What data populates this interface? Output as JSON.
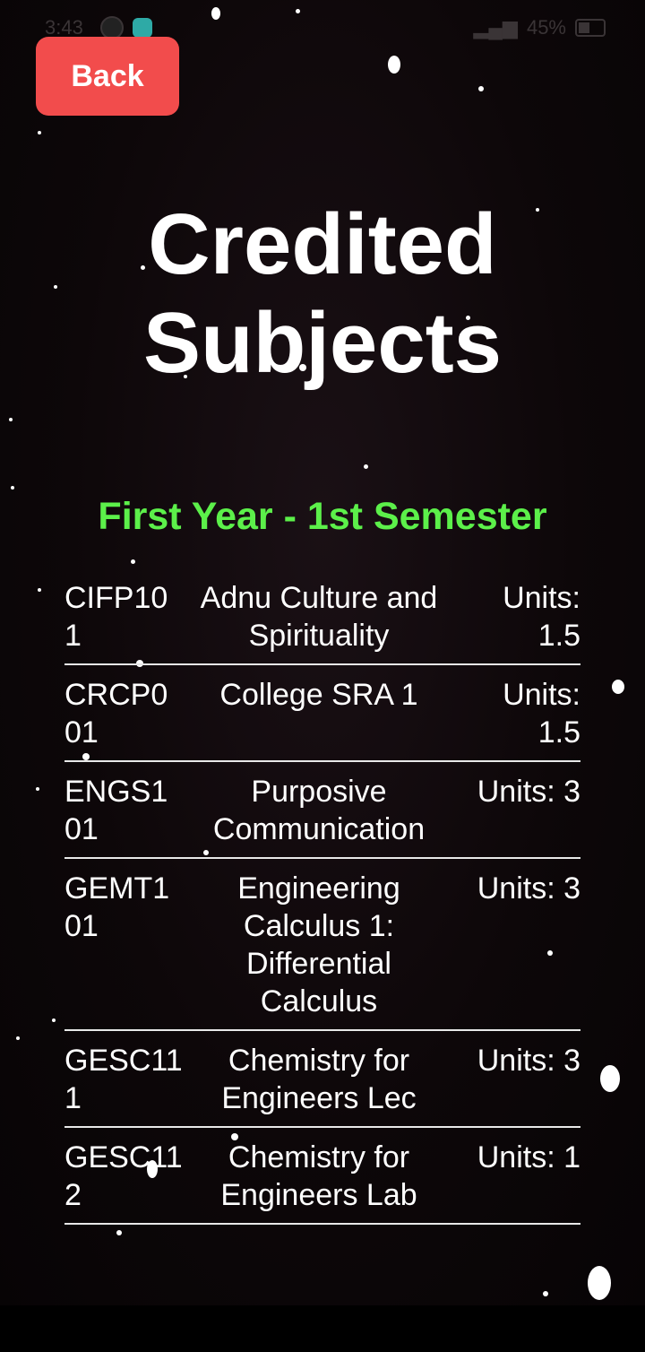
{
  "status_bar": {
    "time": "3:43",
    "battery": "45%"
  },
  "back_label": "Back",
  "title": "Credited Subjects",
  "semester": "First Year - 1st Semester",
  "subjects": [
    {
      "code": "CIFP101",
      "name": "Adnu Culture and Spirituality",
      "units": "Units: 1.5"
    },
    {
      "code": "CRCP001",
      "name": "College SRA 1",
      "units": "Units: 1.5"
    },
    {
      "code": "ENGS101",
      "name": "Purposive Communication",
      "units": "Units: 3"
    },
    {
      "code": "GEMT101",
      "name": "Engineering Calculus 1: Differential Calculus",
      "units": "Units: 3"
    },
    {
      "code": "GESC111",
      "name": "Chemistry for Engineers Lec",
      "units": "Units: 3"
    },
    {
      "code": "GESC112",
      "name": "Chemistry for Engineers Lab",
      "units": "Units: 1"
    }
  ],
  "colors": {
    "accent_red": "#f24c4c",
    "semester_green": "#5cf04a",
    "background": "#0d0709"
  }
}
